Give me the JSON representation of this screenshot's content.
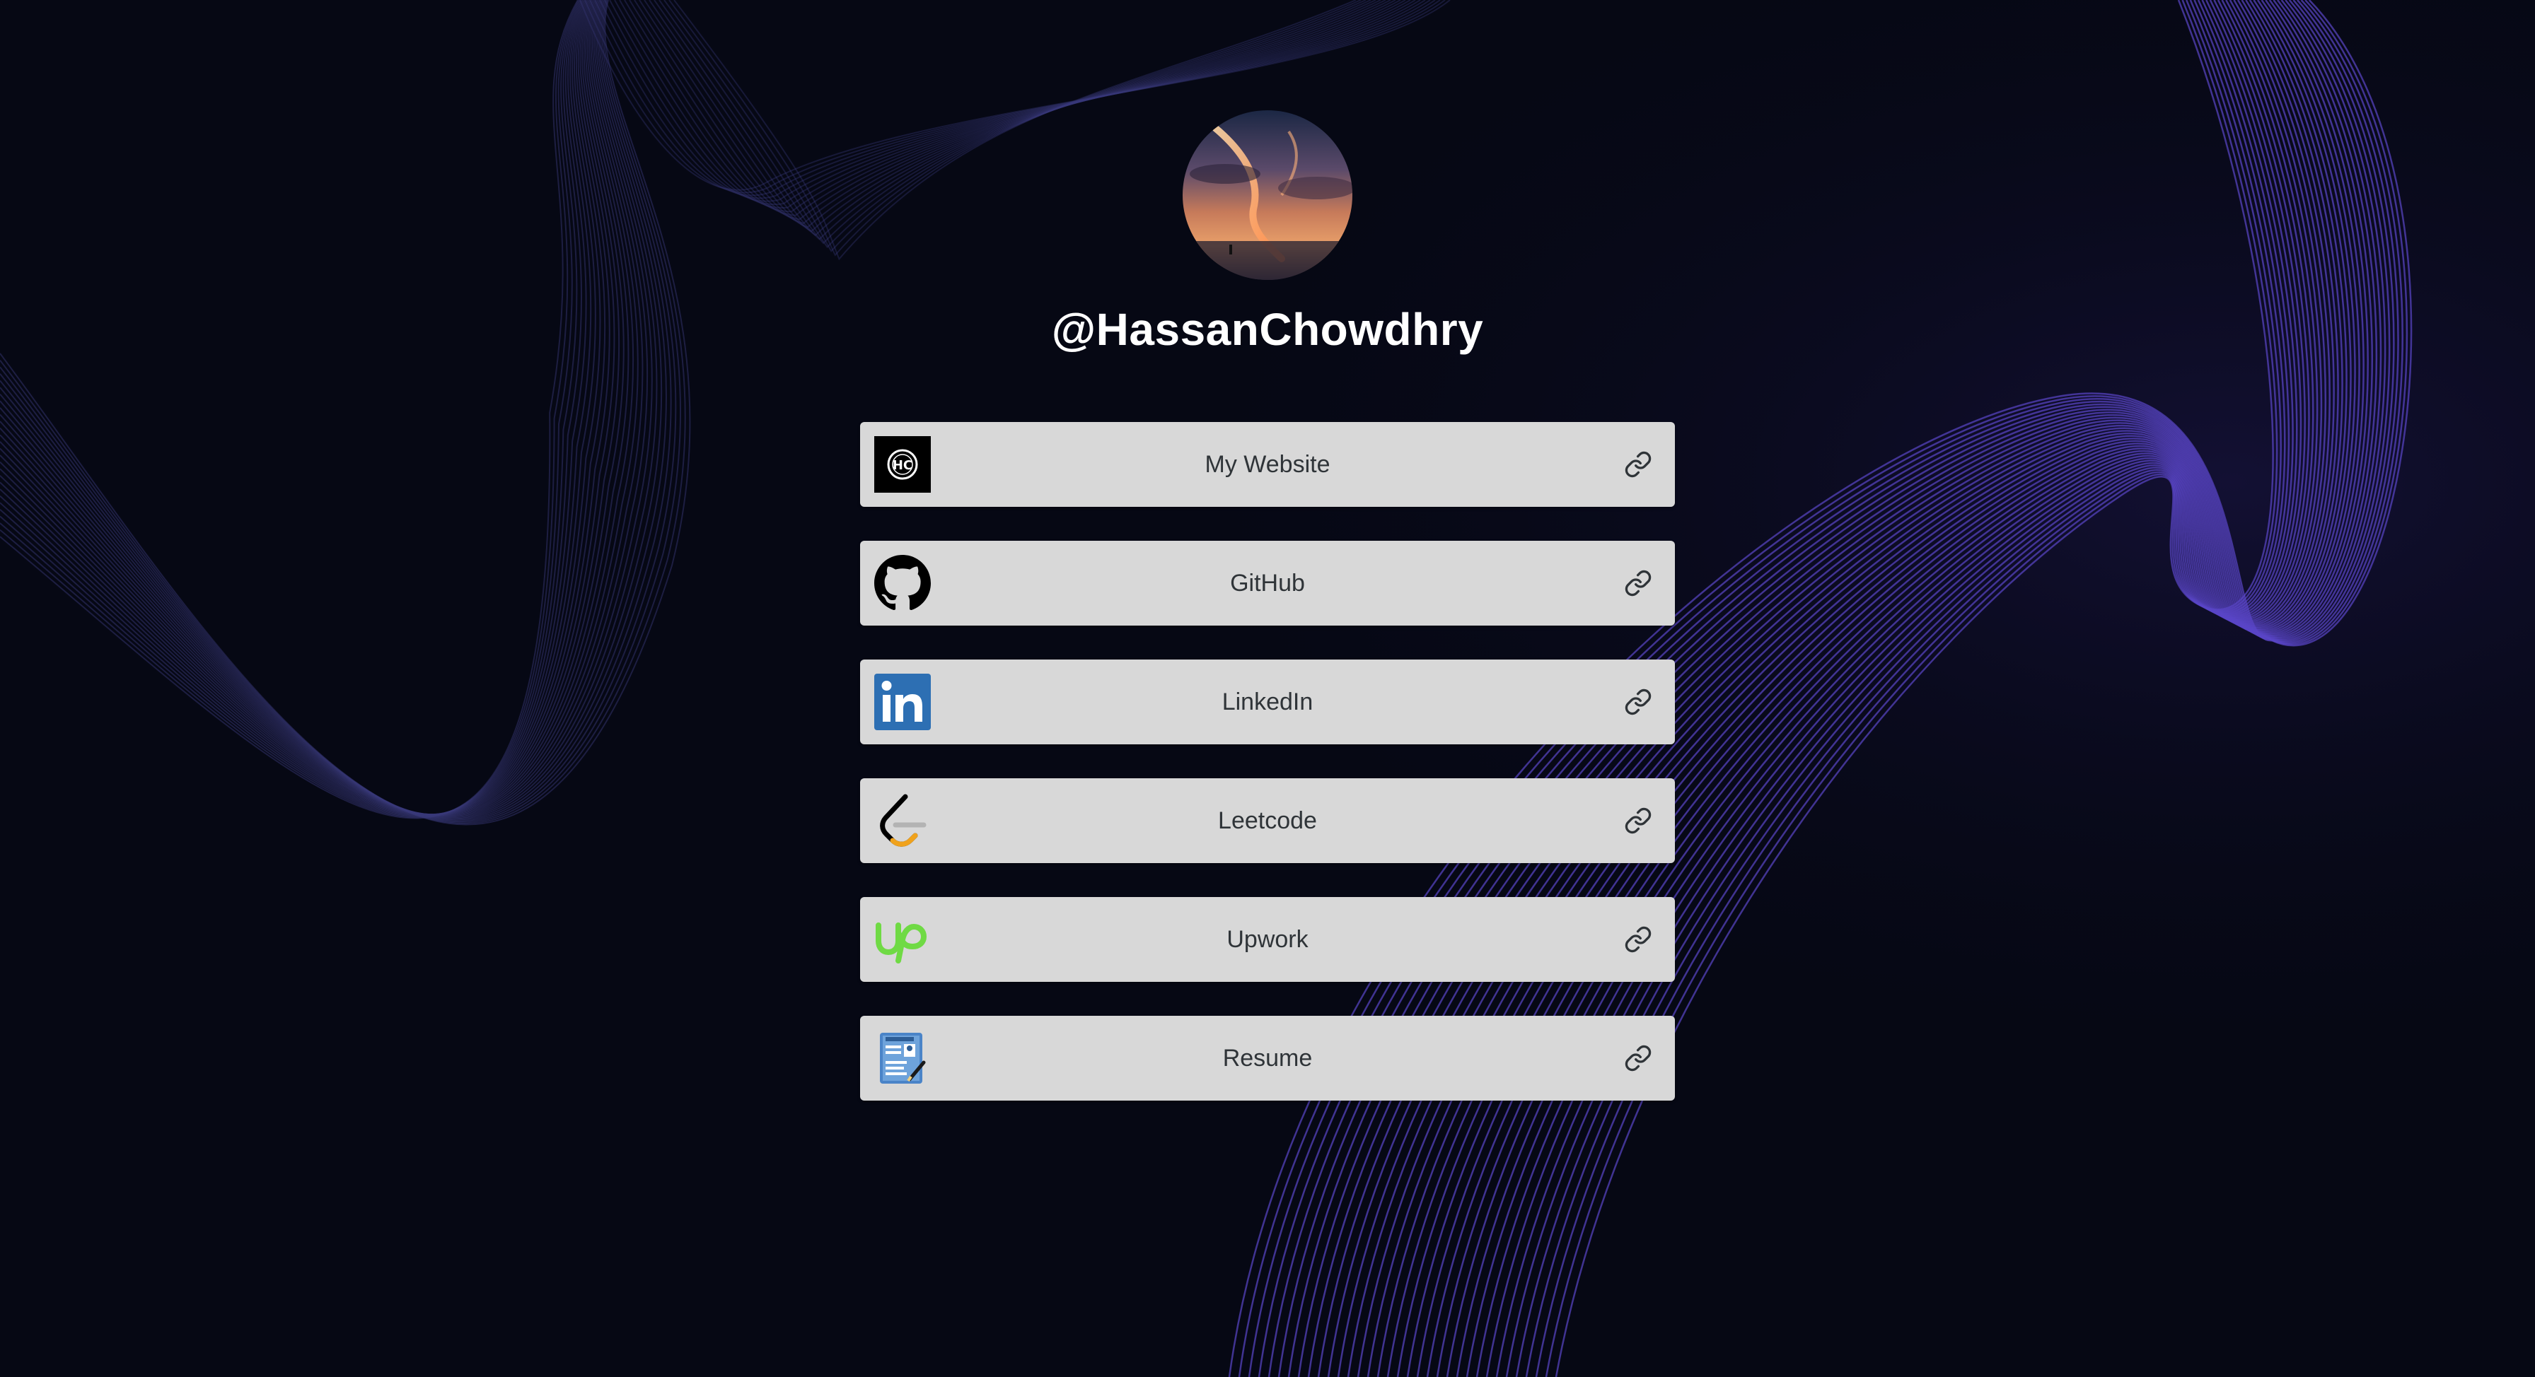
{
  "profile": {
    "handle": "@HassanChowdhry",
    "avatar_icon": "sunset-sky-avatar"
  },
  "links": [
    {
      "label": "My Website",
      "icon": "hc-logo-icon",
      "trailing_icon": "link-icon"
    },
    {
      "label": "GitHub",
      "icon": "github-icon",
      "trailing_icon": "link-icon"
    },
    {
      "label": "LinkedIn",
      "icon": "linkedin-icon",
      "trailing_icon": "link-icon"
    },
    {
      "label": "Leetcode",
      "icon": "leetcode-icon",
      "trailing_icon": "link-icon"
    },
    {
      "label": "Upwork",
      "icon": "upwork-icon",
      "trailing_icon": "link-icon"
    },
    {
      "label": "Resume",
      "icon": "resume-icon",
      "trailing_icon": "link-icon"
    }
  ],
  "colors": {
    "background": "#060814",
    "card": "#d8d8d8",
    "card_text": "#2f3438",
    "accent_wave": "#5a46c8",
    "linkedin": "#2d6fb3",
    "upwork": "#6fda44",
    "leetcode_orange": "#f0a21c"
  }
}
